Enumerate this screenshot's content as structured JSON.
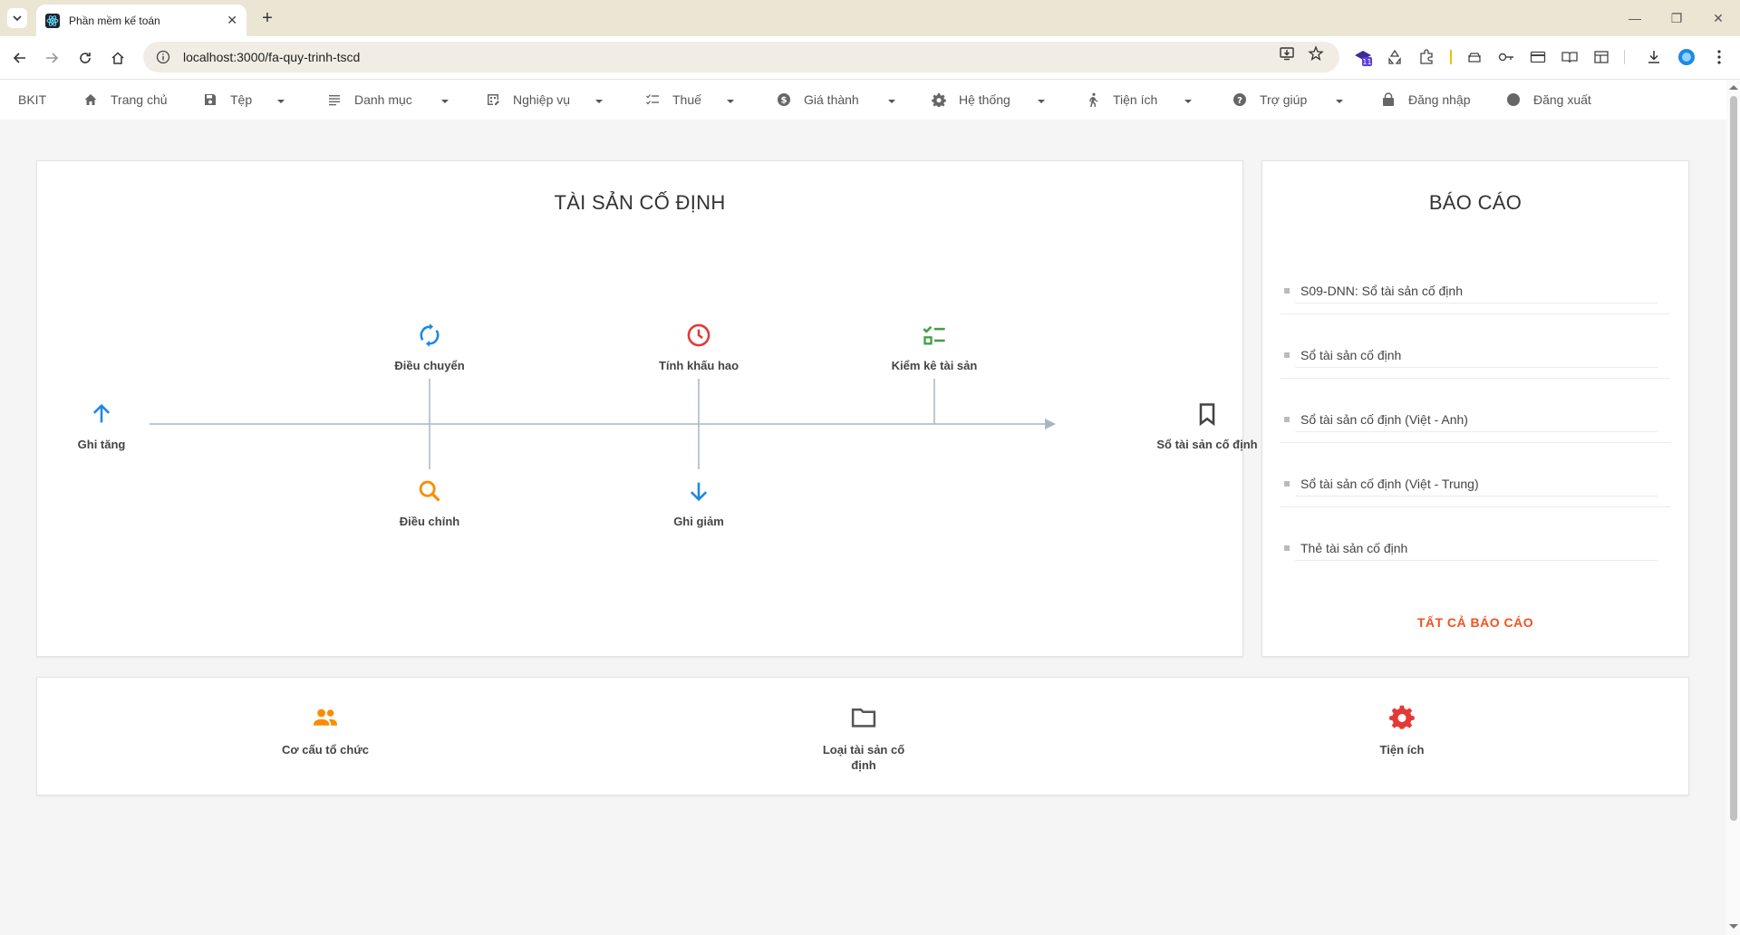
{
  "browser": {
    "tab_title": "Phần mềm kế toán",
    "url": "localhost:3000/fa-quy-trinh-tscd",
    "extension_badge": "11"
  },
  "appnav": {
    "brand": "BKIT",
    "items": [
      {
        "label": "Trang chủ",
        "icon": "home-icon",
        "dropdown": false
      },
      {
        "label": "Tệp",
        "icon": "save-icon",
        "dropdown": true
      },
      {
        "label": "Danh mục",
        "icon": "list-icon",
        "dropdown": true
      },
      {
        "label": "Nghiệp vụ",
        "icon": "grid-edit-icon",
        "dropdown": true
      },
      {
        "label": "Thuế",
        "icon": "checklist-icon",
        "dropdown": true
      },
      {
        "label": "Giá thành",
        "icon": "dollar-icon",
        "dropdown": true
      },
      {
        "label": "Hệ thống",
        "icon": "gear-icon",
        "dropdown": true
      },
      {
        "label": "Tiện ích",
        "icon": "walk-icon",
        "dropdown": true
      },
      {
        "label": "Trợ giúp",
        "icon": "help-icon",
        "dropdown": true
      },
      {
        "label": "Đăng nhập",
        "icon": "lock-icon",
        "dropdown": false
      },
      {
        "label": "Đăng xuất",
        "icon": "circle-icon",
        "dropdown": false
      }
    ]
  },
  "process": {
    "title": "TÀI SẢN CỐ ĐỊNH",
    "nodes": {
      "ghi_tang": "Ghi tăng",
      "dieu_chuyen": "Điều chuyển",
      "tinh_khau_hao": "Tính khấu hao",
      "kiem_ke": "Kiểm kê tài sản",
      "dieu_chinh": "Điều chỉnh",
      "ghi_giam": "Ghi giảm",
      "so_tai_san": "Sổ tài sản cố định"
    },
    "colors": {
      "blue": "#1e88e5",
      "red": "#e53935",
      "green": "#43a047",
      "orange": "#fb8c00",
      "line": "#a9b6c2"
    }
  },
  "reports": {
    "title": "BÁO CÁO",
    "items": [
      "S09-DNN: Sổ tài sản cố định",
      "Sổ tài sản cố định",
      "Sổ tài sản cố định (Việt - Anh)",
      "Sổ tài sản cố định (Việt - Trung)",
      "Thẻ tài sản cố định"
    ],
    "all_label": "TẤT CẢ BÁO CÁO"
  },
  "shortcuts": [
    {
      "label": "Cơ cấu tổ chức",
      "icon": "people-icon",
      "color": "#fb8c00"
    },
    {
      "label": "Loại tài sản cố định",
      "icon": "folder-icon",
      "color": "#555555"
    },
    {
      "label": "Tiện ích",
      "icon": "gear-icon",
      "color": "#e53935"
    }
  ]
}
